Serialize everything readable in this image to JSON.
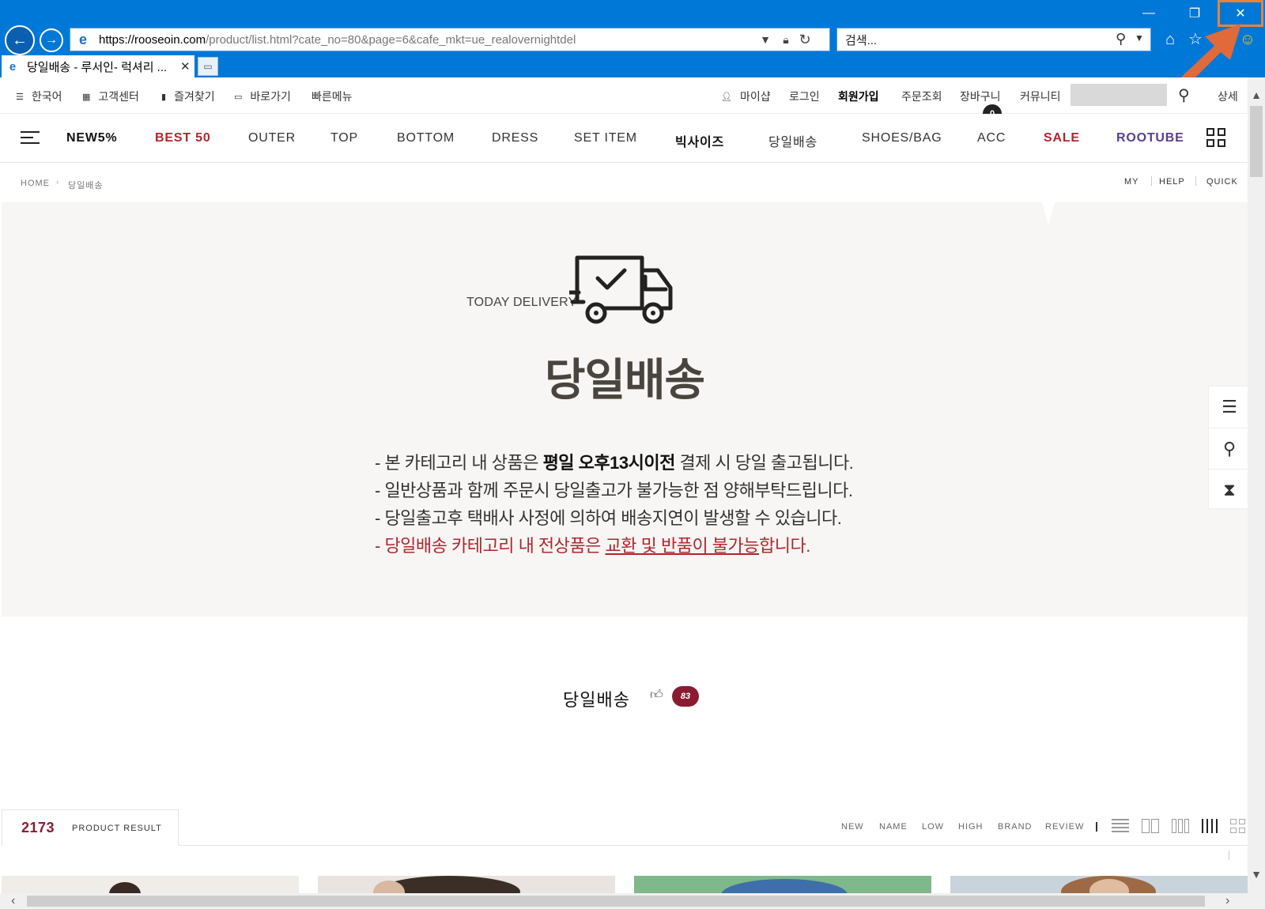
{
  "browser": {
    "url_host": "https://rooseoin.com",
    "url_path": "/product/list.html?cate_no=80&page=6&cafe_mkt=ue_realovernightdel",
    "search_placeholder": "검색...",
    "tab_title": "당일배송 - 루서인- 럭셔리 ...",
    "tab_close": "✕",
    "icons": [
      "ie-icon",
      "lock-icon",
      "refresh-icon",
      "search-icon",
      "home-icon",
      "star-icon",
      "smiley-icon"
    ]
  },
  "util_bar": {
    "lang": "한국어",
    "cs": "고객센터",
    "fav": "즐겨찾기",
    "shortcut": "바로가기",
    "quick_menu": "빠른메뉴",
    "mypage": "마이샵",
    "login": "로그인",
    "join": "회원가입",
    "order": "주문조회",
    "cart": "장바구니",
    "cart_count": "0",
    "community": "커뮤니티",
    "detail": "상세"
  },
  "main_nav": {
    "items": [
      "NEW5%",
      "BEST 50",
      "OUTER",
      "TOP",
      "BOTTOM",
      "DRESS",
      "SET ITEM",
      "빅사이즈",
      "당일배송",
      "SHOES/BAG",
      "ACC",
      "SALE",
      "ROOTUBE"
    ]
  },
  "breadcrumb": {
    "home": "HOME",
    "current": "당일배송",
    "right": [
      "MY",
      "HELP",
      "QUICK"
    ]
  },
  "banner": {
    "label": "TODAY DELIVERY",
    "title": "당일배송",
    "lines": [
      {
        "pre": "- 본 카테고리 내 상품은 ",
        "bold": "평일 오후13시이전",
        "post": " 결제 시 당일 출고됩니다."
      },
      {
        "text": "- 일반상품과 함께 주문시 당일출고가 불가능한 점 양해부탁드립니다."
      },
      {
        "text": "- 당일출고후 택배사 사정에 의하여 배송지연이 발생할 수 있습니다."
      },
      {
        "pre": "- 당일배송 카테고리 내 전상품은 ",
        "underline": "교환 및 반품이 불가능",
        "post": "합니다."
      }
    ],
    "colors": {
      "background": "#f7f6f4",
      "title": "#4a443f",
      "warning": "#b0262d"
    }
  },
  "category": {
    "title": "당일배송",
    "count": "83"
  },
  "results": {
    "count": "2173",
    "label": "PRODUCT RESULT",
    "sort": [
      "NEW",
      "NAME",
      "LOW",
      "HIGH",
      "BRAND",
      "REVIEW"
    ]
  },
  "colors": {
    "chrome": "#0078d7",
    "accent_red": "#b0262d",
    "accent_purple": "#5b3f8c",
    "badge": "#8a1c32"
  }
}
